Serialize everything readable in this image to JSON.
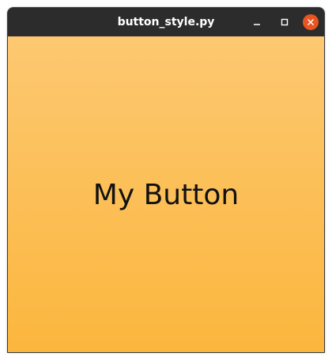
{
  "window": {
    "title": "button_style.py",
    "controls": {
      "minimize_icon": "minimize-icon",
      "maximize_icon": "maximize-icon",
      "close_icon": "close-icon",
      "close_color": "#e95420"
    }
  },
  "content": {
    "button_label": "My Button",
    "gradient_top": "#fdc871",
    "gradient_bottom": "#fbb63d"
  }
}
